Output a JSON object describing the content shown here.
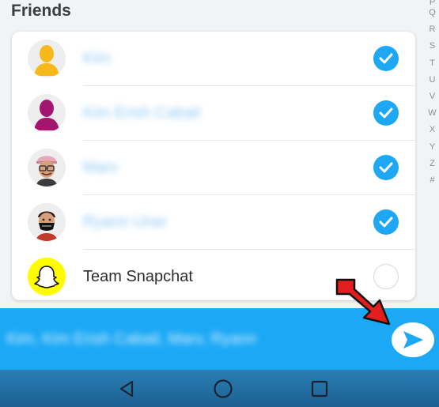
{
  "section": {
    "title": "Friends"
  },
  "alpha_index": [
    "P",
    "Q",
    "R",
    "S",
    "T",
    "U",
    "V",
    "W",
    "X",
    "Y",
    "Z",
    "#"
  ],
  "friends": [
    {
      "name": "Kim",
      "selected": true,
      "avatar": "yellow-silhouette-avatar",
      "blurred": true
    },
    {
      "name": "Kim Erish Cabail",
      "selected": true,
      "avatar": "magenta-silhouette-avatar",
      "blurred": true
    },
    {
      "name": "Marv",
      "selected": true,
      "avatar": "bitmoji-cap-glasses-avatar",
      "blurred": true
    },
    {
      "name": "Ryann Uner",
      "selected": true,
      "avatar": "bitmoji-mask-avatar",
      "blurred": true
    },
    {
      "name": "Team Snapchat",
      "selected": false,
      "avatar": "snapchat-ghost-avatar",
      "blurred": false
    }
  ],
  "send_bar": {
    "recipients": "Kim, Kim Erish Cabail, Marv, Ryann"
  },
  "colors": {
    "accent": "#1ba8f5",
    "check": "#1ea7f3",
    "arrow": "#e31e1e",
    "snap_yellow": "#fffc00"
  }
}
